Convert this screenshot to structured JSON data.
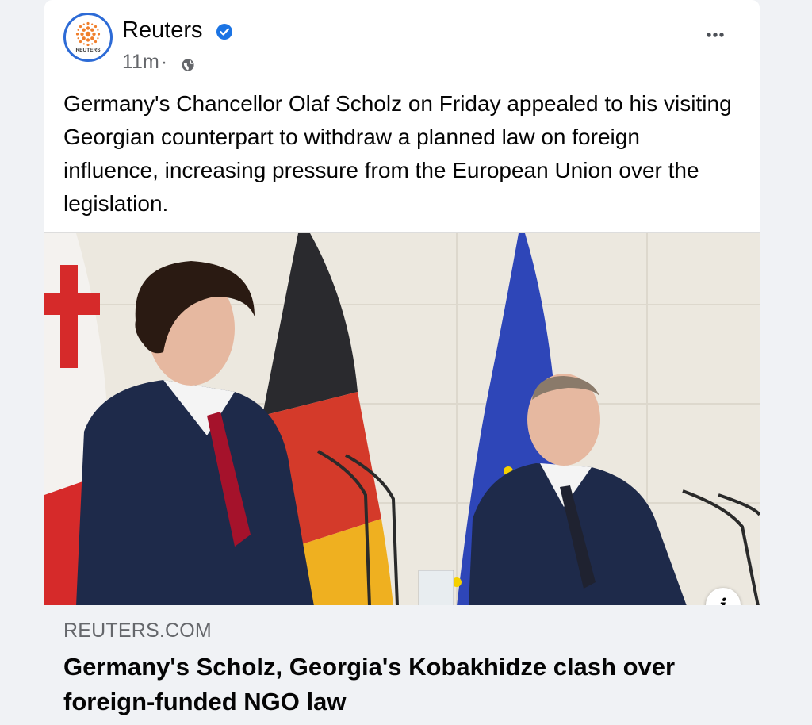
{
  "post": {
    "author": "Reuters",
    "avatar_text": "REUTERS",
    "verified": true,
    "time": "11m",
    "separator": "·",
    "audience_icon": "globe-icon",
    "more_icon": "more-options-icon",
    "caption": "Germany's Chancellor Olaf Scholz on Friday appealed to his visiting Georgian counterpart to withdraw a planned law on foreign influence, increasing pressure from the European Union over the legislation."
  },
  "link": {
    "domain": "REUTERS.COM",
    "headline": "Germany's Scholz, Georgia's Kobakhidze clash over foreign-funded NGO law",
    "info_icon": "info-icon",
    "info_glyph": "i"
  },
  "colors": {
    "verified_blue": "#1b74e4",
    "reuters_orange": "#f07f2c",
    "muted_text": "#65676b",
    "link_bg": "#f0f2f5"
  }
}
